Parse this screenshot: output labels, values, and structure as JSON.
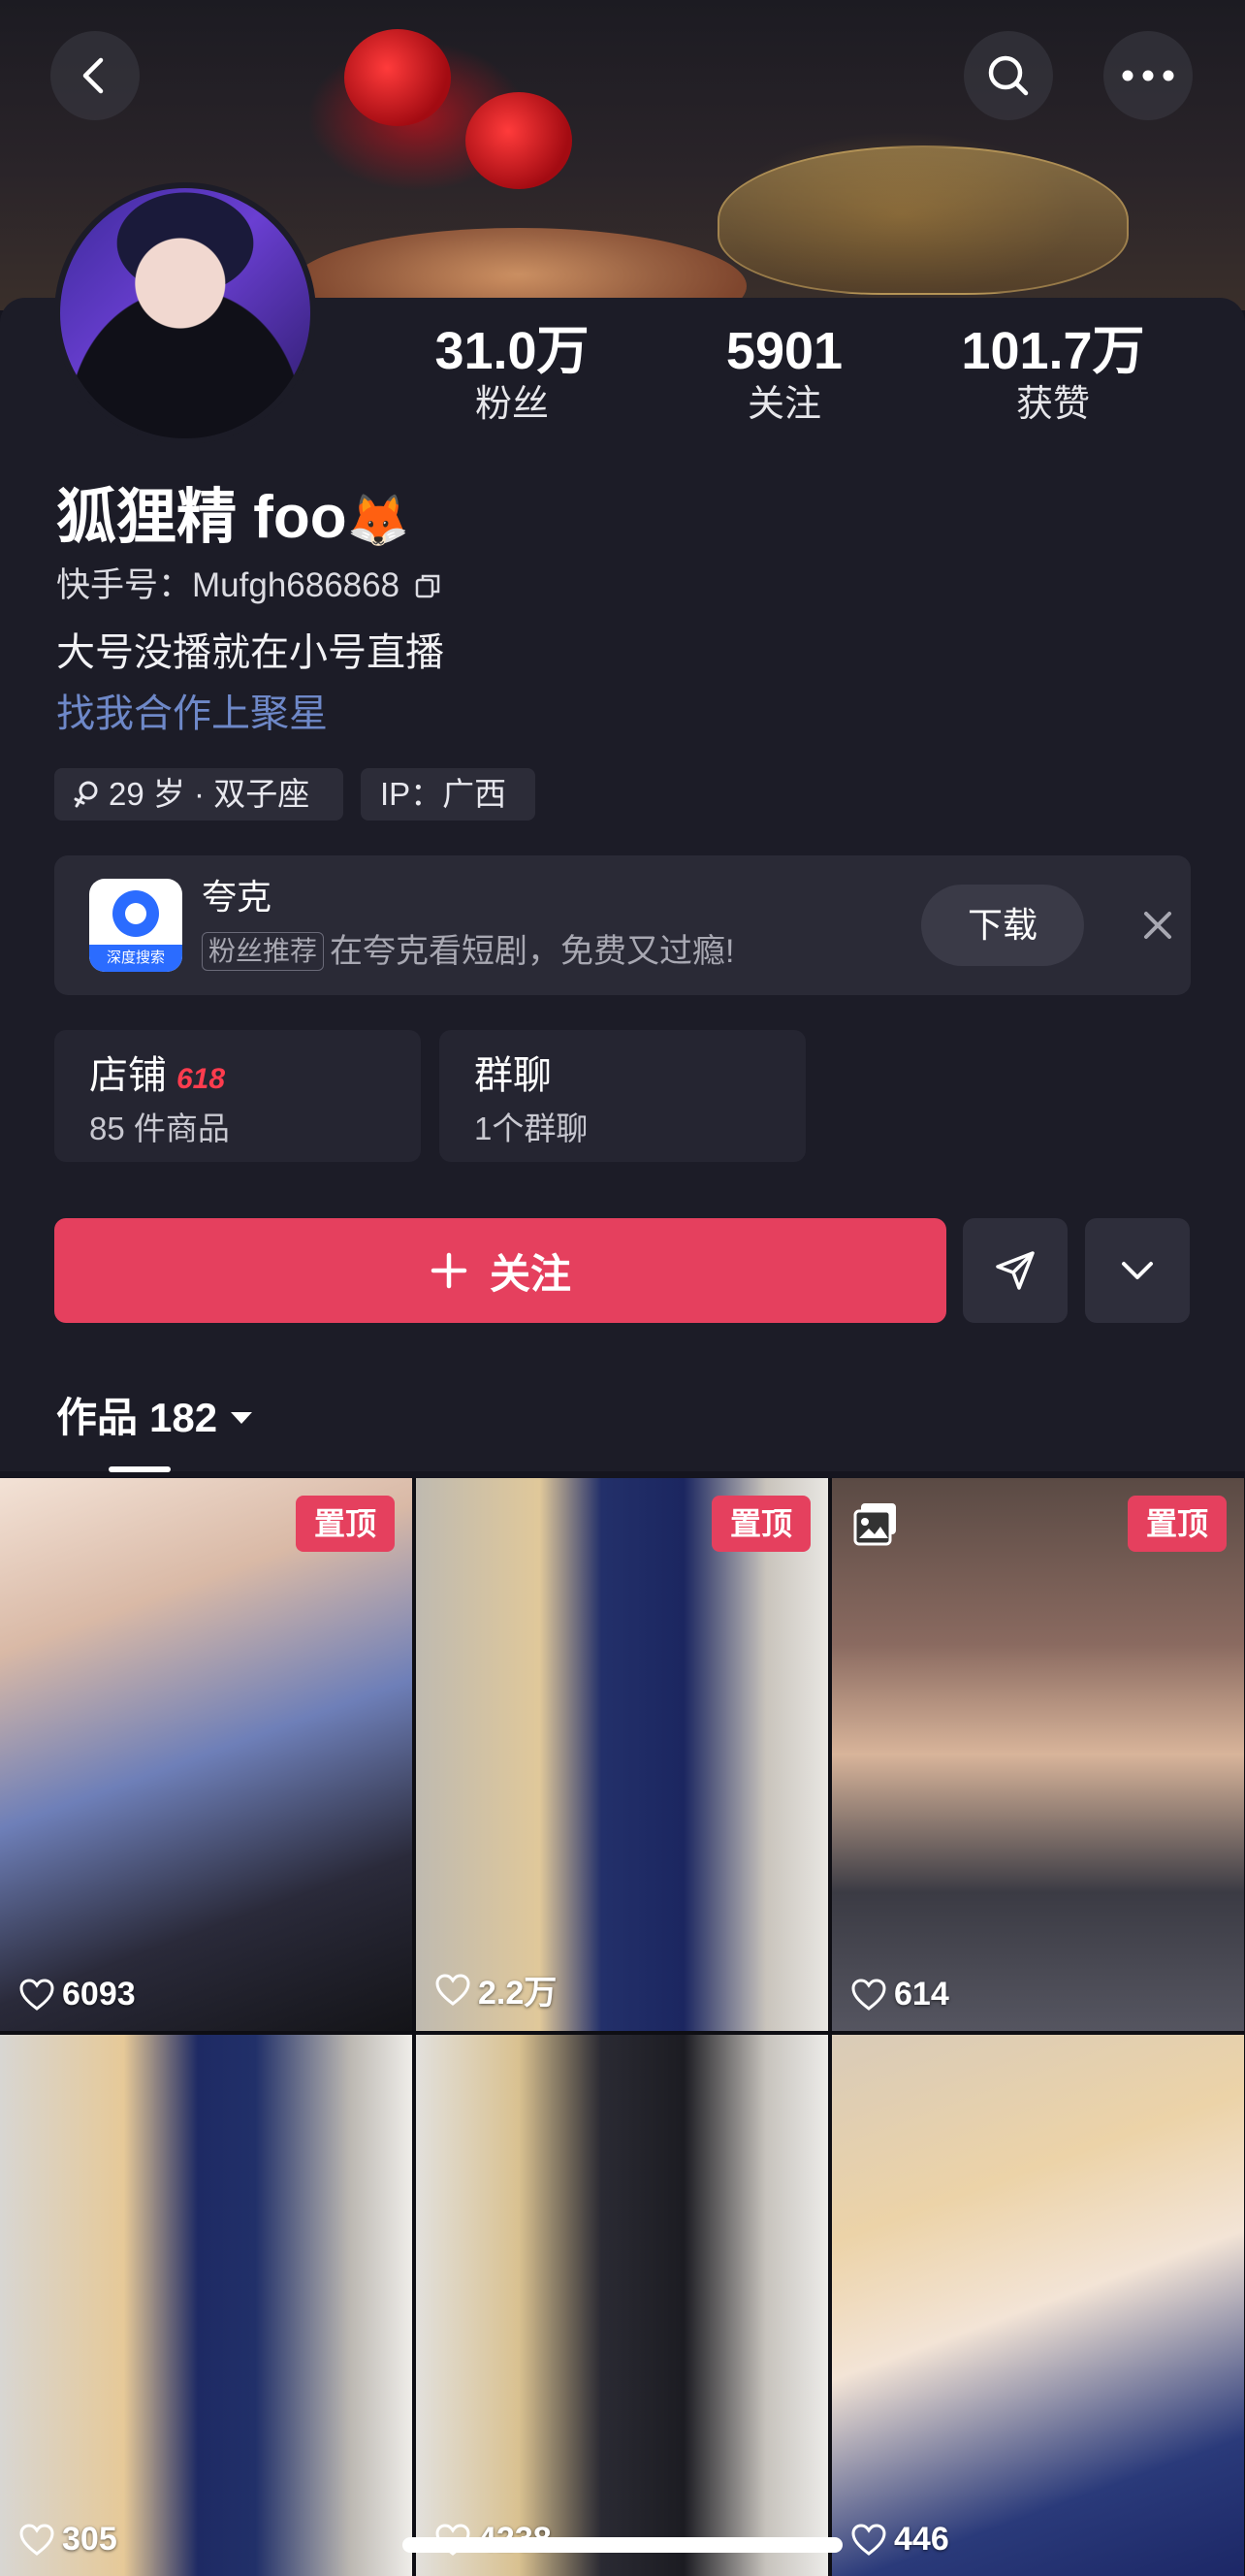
{
  "profile": {
    "name": "狐狸精 foo",
    "name_emoji": "🦊",
    "id_label": "快手号：",
    "id_value": "Mufgh686868",
    "bio": "大号没播就在小号直播",
    "link": "找我合作上聚星",
    "tags": [
      "29 岁 · 双子座",
      "IP：广西"
    ]
  },
  "stats": [
    {
      "value": "31.0万",
      "label": "粉丝"
    },
    {
      "value": "5901",
      "label": "关注"
    },
    {
      "value": "101.7万",
      "label": "获赞"
    }
  ],
  "ad": {
    "title": "夸克",
    "badge": "粉丝推荐",
    "text": "在夸克看短剧，免费又过瘾!",
    "logo_text": "深度搜索",
    "button": "下载"
  },
  "shop": {
    "title": "店铺",
    "promo": "618",
    "sub": "85 件商品"
  },
  "group": {
    "title": "群聊",
    "sub": "1个群聊"
  },
  "follow_label": "关注",
  "works": {
    "label": "作品",
    "count": "182"
  },
  "posts": [
    {
      "likes": "6093",
      "pinned": "置顶",
      "photo": false
    },
    {
      "likes": "2.2万",
      "pinned": "置顶",
      "photo": false
    },
    {
      "likes": "614",
      "pinned": "置顶",
      "photo": true
    },
    {
      "likes": "305",
      "pinned": "",
      "photo": false
    },
    {
      "likes": "4238",
      "pinned": "",
      "photo": false
    },
    {
      "likes": "446",
      "pinned": "",
      "photo": false
    }
  ],
  "colors": {
    "accent": "#e5405e",
    "link": "#6e88c8",
    "background": "#1c1c27"
  },
  "icons": [
    "back-arrow-icon",
    "search-icon",
    "more-icon",
    "copy-icon",
    "gender-icon",
    "close-icon",
    "plus-icon",
    "send-icon",
    "chevron-down-icon",
    "heart-icon",
    "photo-icon"
  ]
}
